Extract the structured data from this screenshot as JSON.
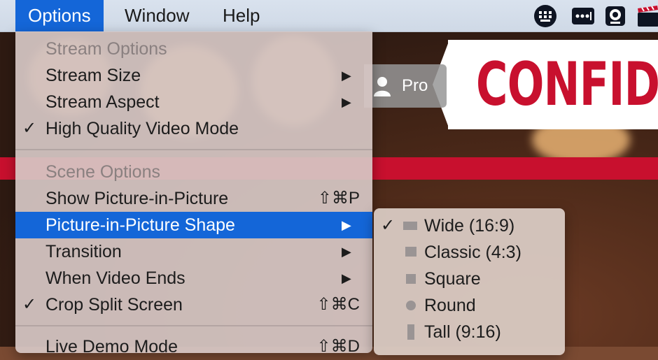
{
  "menubar": {
    "items": [
      {
        "label": "Options",
        "active": true
      },
      {
        "label": "Window",
        "active": false
      },
      {
        "label": "Help",
        "active": false
      }
    ],
    "accent": "#1466d8",
    "tray_icons": [
      "grid-icon",
      "more-icon",
      "camera-icon",
      "clapper-icon"
    ]
  },
  "scene": {
    "pro_label": "Pro",
    "banner_text": "CONFIDI",
    "brand_red": "#c8102e"
  },
  "menu": {
    "items": [
      {
        "label": "Stream Options",
        "type": "header"
      },
      {
        "label": "Stream Size",
        "submenu": true
      },
      {
        "label": "Stream Aspect",
        "submenu": true
      },
      {
        "label": "High Quality Video Mode",
        "checked": true
      },
      {
        "label": "Scene Options",
        "type": "header"
      },
      {
        "label": "Show Picture-in-Picture",
        "shortcut": "⇧⌘P"
      },
      {
        "label": "Picture-in-Picture Shape",
        "submenu": true,
        "highlighted": true
      },
      {
        "label": "Transition",
        "submenu": true
      },
      {
        "label": "When Video Ends",
        "submenu": true
      },
      {
        "label": "Crop Split Screen",
        "checked": true,
        "shortcut": "⇧⌘C"
      },
      {
        "label": "Live Demo Mode",
        "shortcut": "⇧⌘D"
      }
    ],
    "check_glyph": "✓",
    "arrow_glyph": "▶"
  },
  "submenu": {
    "items": [
      {
        "label": "Wide (16:9)",
        "checked": true,
        "shape": "wide"
      },
      {
        "label": "Classic (4:3)",
        "checked": false,
        "shape": "classic"
      },
      {
        "label": "Square",
        "checked": false,
        "shape": "square"
      },
      {
        "label": "Round",
        "checked": false,
        "shape": "round"
      },
      {
        "label": "Tall (9:16)",
        "checked": false,
        "shape": "tall"
      }
    ]
  }
}
